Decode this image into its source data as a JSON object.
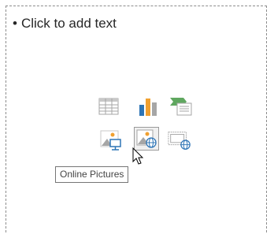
{
  "slide": {
    "placeholder_text": "Click to add text",
    "bullet": "•"
  },
  "content_icons": {
    "row1": [
      "table-icon",
      "chart-icon",
      "smartart-icon"
    ],
    "row2": [
      "pictures-icon",
      "online-pictures-icon",
      "video-icon"
    ]
  },
  "tooltip": {
    "text": "Online Pictures"
  },
  "colors": {
    "icon_gray": "#a6a6a6",
    "icon_blue": "#2e75b6",
    "icon_orange": "#f0a030",
    "icon_green": "#5fa75f",
    "border": "#8c8c8c"
  }
}
